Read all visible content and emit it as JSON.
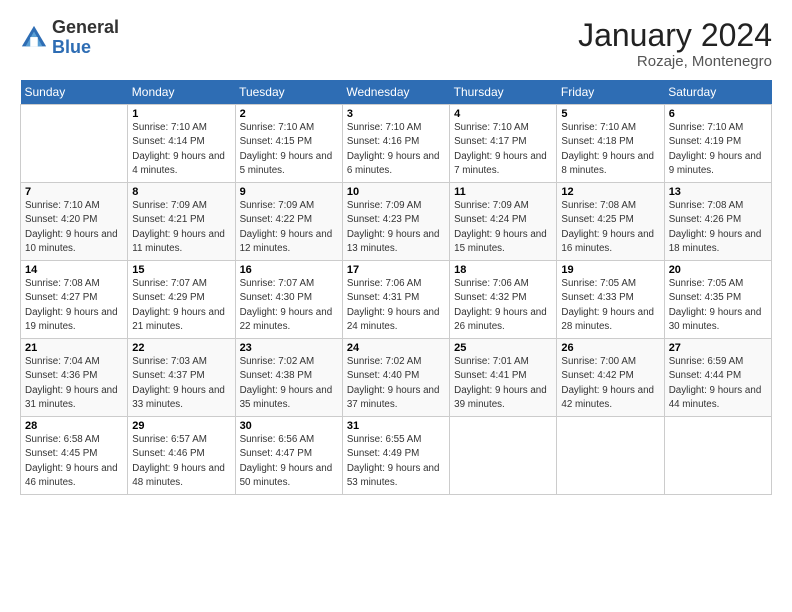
{
  "header": {
    "logo_general": "General",
    "logo_blue": "Blue",
    "month": "January 2024",
    "location": "Rozaje, Montenegro"
  },
  "days_of_week": [
    "Sunday",
    "Monday",
    "Tuesday",
    "Wednesday",
    "Thursday",
    "Friday",
    "Saturday"
  ],
  "weeks": [
    [
      {
        "num": "",
        "sunrise": "",
        "sunset": "",
        "daylight": ""
      },
      {
        "num": "1",
        "sunrise": "Sunrise: 7:10 AM",
        "sunset": "Sunset: 4:14 PM",
        "daylight": "Daylight: 9 hours and 4 minutes."
      },
      {
        "num": "2",
        "sunrise": "Sunrise: 7:10 AM",
        "sunset": "Sunset: 4:15 PM",
        "daylight": "Daylight: 9 hours and 5 minutes."
      },
      {
        "num": "3",
        "sunrise": "Sunrise: 7:10 AM",
        "sunset": "Sunset: 4:16 PM",
        "daylight": "Daylight: 9 hours and 6 minutes."
      },
      {
        "num": "4",
        "sunrise": "Sunrise: 7:10 AM",
        "sunset": "Sunset: 4:17 PM",
        "daylight": "Daylight: 9 hours and 7 minutes."
      },
      {
        "num": "5",
        "sunrise": "Sunrise: 7:10 AM",
        "sunset": "Sunset: 4:18 PM",
        "daylight": "Daylight: 9 hours and 8 minutes."
      },
      {
        "num": "6",
        "sunrise": "Sunrise: 7:10 AM",
        "sunset": "Sunset: 4:19 PM",
        "daylight": "Daylight: 9 hours and 9 minutes."
      }
    ],
    [
      {
        "num": "7",
        "sunrise": "Sunrise: 7:10 AM",
        "sunset": "Sunset: 4:20 PM",
        "daylight": "Daylight: 9 hours and 10 minutes."
      },
      {
        "num": "8",
        "sunrise": "Sunrise: 7:09 AM",
        "sunset": "Sunset: 4:21 PM",
        "daylight": "Daylight: 9 hours and 11 minutes."
      },
      {
        "num": "9",
        "sunrise": "Sunrise: 7:09 AM",
        "sunset": "Sunset: 4:22 PM",
        "daylight": "Daylight: 9 hours and 12 minutes."
      },
      {
        "num": "10",
        "sunrise": "Sunrise: 7:09 AM",
        "sunset": "Sunset: 4:23 PM",
        "daylight": "Daylight: 9 hours and 13 minutes."
      },
      {
        "num": "11",
        "sunrise": "Sunrise: 7:09 AM",
        "sunset": "Sunset: 4:24 PM",
        "daylight": "Daylight: 9 hours and 15 minutes."
      },
      {
        "num": "12",
        "sunrise": "Sunrise: 7:08 AM",
        "sunset": "Sunset: 4:25 PM",
        "daylight": "Daylight: 9 hours and 16 minutes."
      },
      {
        "num": "13",
        "sunrise": "Sunrise: 7:08 AM",
        "sunset": "Sunset: 4:26 PM",
        "daylight": "Daylight: 9 hours and 18 minutes."
      }
    ],
    [
      {
        "num": "14",
        "sunrise": "Sunrise: 7:08 AM",
        "sunset": "Sunset: 4:27 PM",
        "daylight": "Daylight: 9 hours and 19 minutes."
      },
      {
        "num": "15",
        "sunrise": "Sunrise: 7:07 AM",
        "sunset": "Sunset: 4:29 PM",
        "daylight": "Daylight: 9 hours and 21 minutes."
      },
      {
        "num": "16",
        "sunrise": "Sunrise: 7:07 AM",
        "sunset": "Sunset: 4:30 PM",
        "daylight": "Daylight: 9 hours and 22 minutes."
      },
      {
        "num": "17",
        "sunrise": "Sunrise: 7:06 AM",
        "sunset": "Sunset: 4:31 PM",
        "daylight": "Daylight: 9 hours and 24 minutes."
      },
      {
        "num": "18",
        "sunrise": "Sunrise: 7:06 AM",
        "sunset": "Sunset: 4:32 PM",
        "daylight": "Daylight: 9 hours and 26 minutes."
      },
      {
        "num": "19",
        "sunrise": "Sunrise: 7:05 AM",
        "sunset": "Sunset: 4:33 PM",
        "daylight": "Daylight: 9 hours and 28 minutes."
      },
      {
        "num": "20",
        "sunrise": "Sunrise: 7:05 AM",
        "sunset": "Sunset: 4:35 PM",
        "daylight": "Daylight: 9 hours and 30 minutes."
      }
    ],
    [
      {
        "num": "21",
        "sunrise": "Sunrise: 7:04 AM",
        "sunset": "Sunset: 4:36 PM",
        "daylight": "Daylight: 9 hours and 31 minutes."
      },
      {
        "num": "22",
        "sunrise": "Sunrise: 7:03 AM",
        "sunset": "Sunset: 4:37 PM",
        "daylight": "Daylight: 9 hours and 33 minutes."
      },
      {
        "num": "23",
        "sunrise": "Sunrise: 7:02 AM",
        "sunset": "Sunset: 4:38 PM",
        "daylight": "Daylight: 9 hours and 35 minutes."
      },
      {
        "num": "24",
        "sunrise": "Sunrise: 7:02 AM",
        "sunset": "Sunset: 4:40 PM",
        "daylight": "Daylight: 9 hours and 37 minutes."
      },
      {
        "num": "25",
        "sunrise": "Sunrise: 7:01 AM",
        "sunset": "Sunset: 4:41 PM",
        "daylight": "Daylight: 9 hours and 39 minutes."
      },
      {
        "num": "26",
        "sunrise": "Sunrise: 7:00 AM",
        "sunset": "Sunset: 4:42 PM",
        "daylight": "Daylight: 9 hours and 42 minutes."
      },
      {
        "num": "27",
        "sunrise": "Sunrise: 6:59 AM",
        "sunset": "Sunset: 4:44 PM",
        "daylight": "Daylight: 9 hours and 44 minutes."
      }
    ],
    [
      {
        "num": "28",
        "sunrise": "Sunrise: 6:58 AM",
        "sunset": "Sunset: 4:45 PM",
        "daylight": "Daylight: 9 hours and 46 minutes."
      },
      {
        "num": "29",
        "sunrise": "Sunrise: 6:57 AM",
        "sunset": "Sunset: 4:46 PM",
        "daylight": "Daylight: 9 hours and 48 minutes."
      },
      {
        "num": "30",
        "sunrise": "Sunrise: 6:56 AM",
        "sunset": "Sunset: 4:47 PM",
        "daylight": "Daylight: 9 hours and 50 minutes."
      },
      {
        "num": "31",
        "sunrise": "Sunrise: 6:55 AM",
        "sunset": "Sunset: 4:49 PM",
        "daylight": "Daylight: 9 hours and 53 minutes."
      },
      {
        "num": "",
        "sunrise": "",
        "sunset": "",
        "daylight": ""
      },
      {
        "num": "",
        "sunrise": "",
        "sunset": "",
        "daylight": ""
      },
      {
        "num": "",
        "sunrise": "",
        "sunset": "",
        "daylight": ""
      }
    ]
  ]
}
